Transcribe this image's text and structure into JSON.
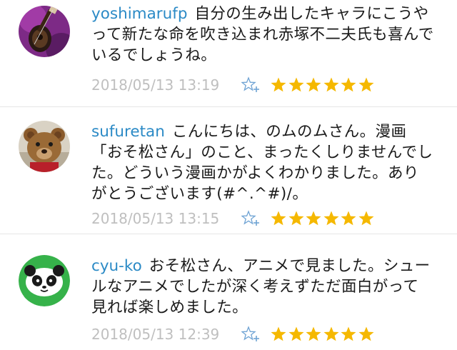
{
  "comments": [
    {
      "username": "yoshimarufp",
      "text": "自分の生み出したキャラにこうやって新たな命を吹き込まれ赤塚不二夫氏も喜んでいるでしょうね。",
      "timestamp": "2018/05/13 13:19",
      "rating": 6,
      "avatar_icon": "guitar-avatar-icon"
    },
    {
      "username": "sufuretan",
      "text": "こんにちは、のムのムさん。漫画「おそ松さん」のこと、まったくしりませんでした。どういう漫画かがよくわかりました。ありがとうございます(#^.^#)/。",
      "timestamp": "2018/05/13 13:15",
      "rating": 6,
      "avatar_icon": "teddy-bear-avatar-icon"
    },
    {
      "username": "cyu-ko",
      "text": "おそ松さん、アニメで見ました。シュールなアニメでしたが深く考えずただ面白がって見れば楽しめました。",
      "timestamp": "2018/05/13 12:39",
      "rating": 6,
      "avatar_icon": "panda-avatar-icon"
    }
  ],
  "colors": {
    "username": "#2b8ac6",
    "timestamp": "#bfbfbf",
    "star": "#f5b800",
    "divider": "#e6e6e6"
  }
}
